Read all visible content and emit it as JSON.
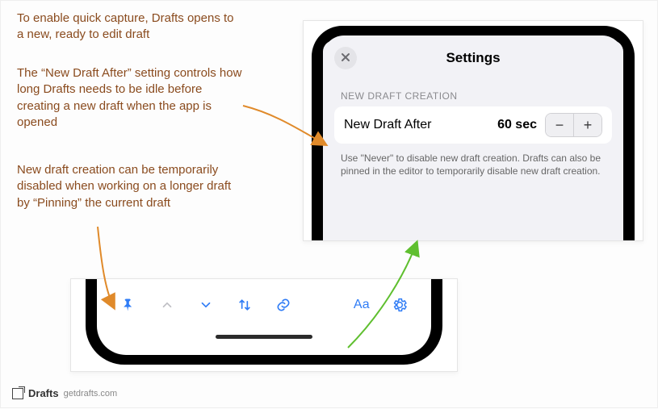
{
  "captions": {
    "c1": "To enable quick capture, Drafts opens to a new, ready to edit draft",
    "c2": "The “New Draft After” setting controls how long Drafts needs to be idle before creating a new draft when the app is opened",
    "c3": "New draft creation can be temporarily disabled when working on a longer draft by “Pinning” the current draft"
  },
  "settings": {
    "title": "Settings",
    "section": "NEW DRAFT CREATION",
    "row_label": "New Draft After",
    "row_value": "60 sec",
    "minus": "−",
    "plus": "+",
    "footnote": "Use \"Never\" to disable new draft creation. Drafts can also be pinned in the editor to temporarily disable new draft creation."
  },
  "toolbar": {
    "aa": "Aa"
  },
  "credit": {
    "brand": "Drafts",
    "url": "getdrafts.com"
  },
  "colors": {
    "caption": "#8a4b1e",
    "ios_blue": "#2f7cf6",
    "arrow_orange": "#e08a2a",
    "arrow_green": "#5fbf2f"
  }
}
